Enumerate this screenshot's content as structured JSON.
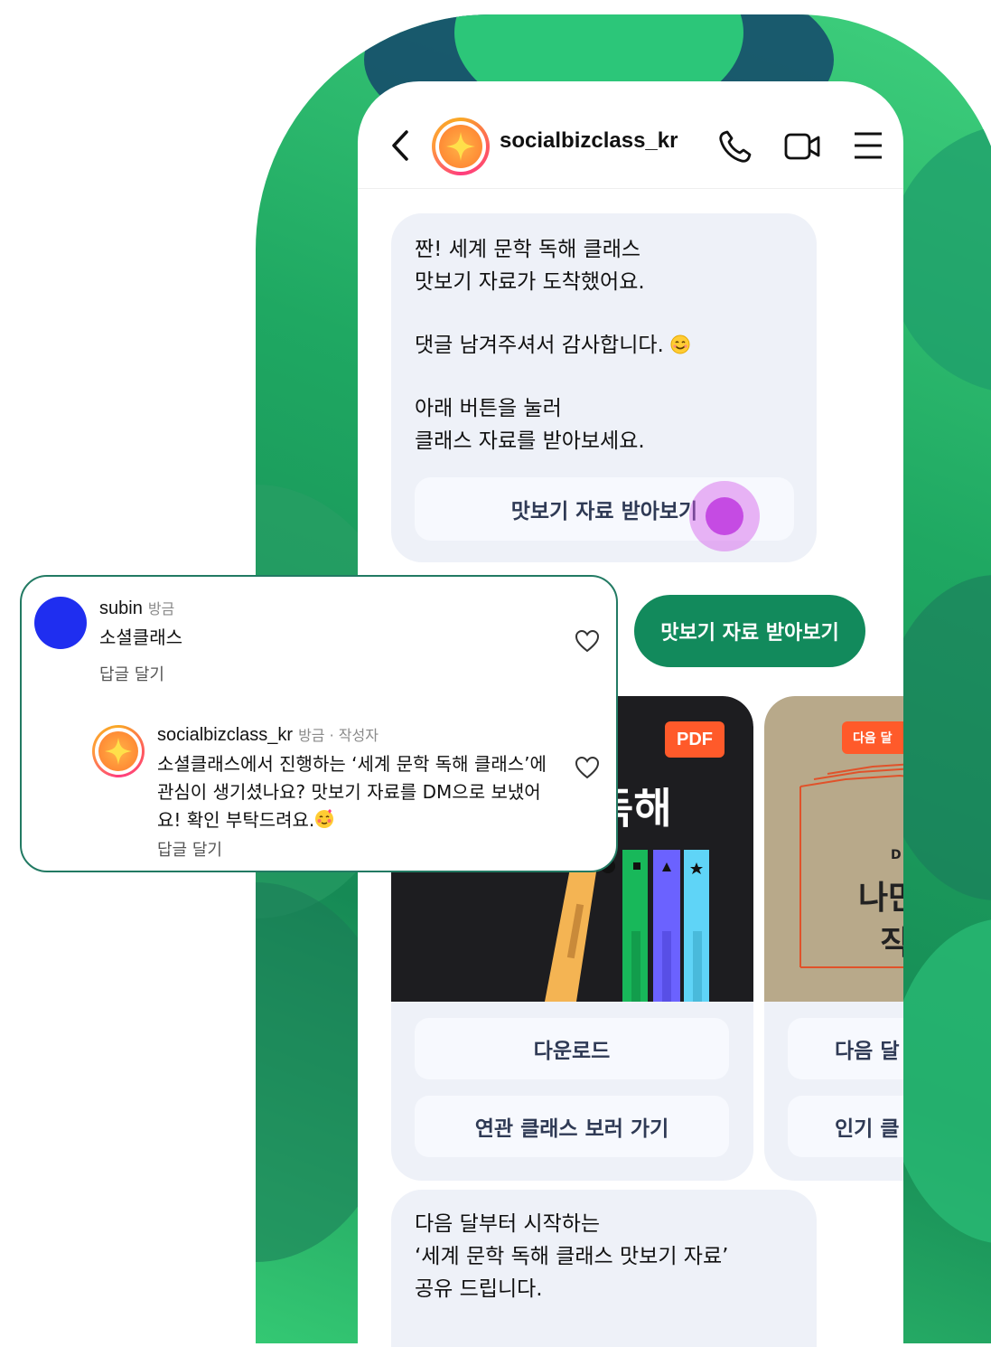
{
  "header": {
    "account_name": "socialbizclass_kr"
  },
  "messages": {
    "intro_line1": "짠! 세계 문학 독해 클래스",
    "intro_line2": "맛보기 자료가 도착했어요.",
    "thanks": "댓글 남겨주셔서 감사합니다.",
    "guide_line1": "아래 버튼을 눌러",
    "guide_line2": "클래스 자료를 받아보세요.",
    "bubble_button": "맛보기 자료 받아보기",
    "quick_reply": "맛보기 자료 받아보기"
  },
  "cards": [
    {
      "badge": "PDF",
      "cover_title": "독해",
      "buttons": [
        "다운로드",
        "연관 클래스 보러 가기"
      ]
    },
    {
      "badge": "다음 달",
      "cover_small": "D",
      "cover_line1": "나만",
      "cover_line2": "직",
      "buttons": [
        "다음 달",
        "인기 클"
      ]
    }
  ],
  "bottom_message": {
    "line1": "다음 달부터 시작하는",
    "line2": "‘세계 문학 독해 클래스 맛보기 자료’",
    "line3": "공유 드립니다."
  },
  "comments": [
    {
      "username": "subin",
      "time": "방금",
      "text": "소셜클래스",
      "reply": "답글 달기"
    },
    {
      "username": "socialbizclass_kr",
      "time": "방금 · 작성자",
      "text_line1": "소셜클래스에서 진행하는 ‘세계 문학 독해 클래스’에",
      "text_line2": "관심이 생기셨나요? 맛보기 자료를 DM으로 보냈어",
      "text_line3": "요! 확인 부탁드려요.",
      "reply": "답글 달기"
    }
  ],
  "colors": {
    "brand_green": "#128a5c",
    "bubble_bg": "#eef1f8",
    "pdf_badge": "#ff5a2a",
    "comment_border": "#227a63"
  },
  "icons": [
    "back-icon",
    "profile-avatar-icon",
    "phone-call-icon",
    "video-call-icon",
    "menu-icon",
    "smile-emoji-icon",
    "heart-icon",
    "blush-emoji-icon"
  ]
}
